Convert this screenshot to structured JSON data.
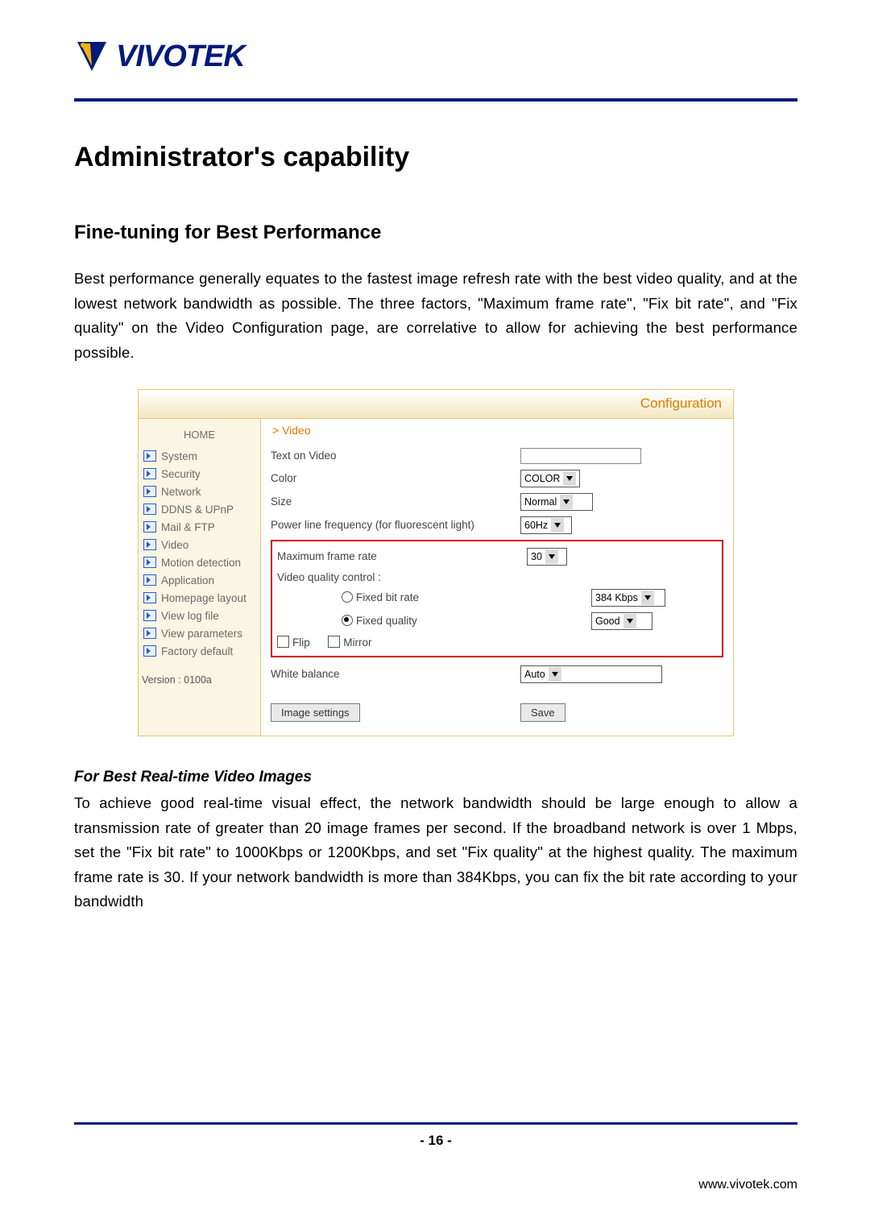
{
  "logo": {
    "text": "VIVOTEK"
  },
  "title": "Administrator's capability",
  "sub1": "Fine-tuning for Best Performance",
  "para1": "Best performance generally equates to the fastest image refresh rate with the best video quality, and at the lowest network bandwidth as possible. The three factors, \"Maximum frame rate\", \"Fix bit rate\", and \"Fix quality\" on the Video Configuration page, are correlative to allow for achieving the best performance possible.",
  "shot": {
    "title": "Configuration",
    "crumb": "> Video",
    "home": "HOME",
    "side": [
      "System",
      "Security",
      "Network",
      "DDNS & UPnP",
      "Mail & FTP",
      "Video",
      "Motion detection",
      "Application",
      "Homepage layout",
      "View log file",
      "View parameters",
      "Factory default"
    ],
    "version": "Version : 0100a",
    "labels": {
      "text_on_video": "Text on Video",
      "color": "Color",
      "size": "Size",
      "plf": "Power line frequency (for fluorescent light)",
      "mfr": "Maximum frame rate",
      "vqc": "Video quality control :",
      "fbr": "Fixed bit rate",
      "fq": "Fixed quality",
      "flip": "Flip",
      "mirror": "Mirror",
      "wb": "White balance"
    },
    "values": {
      "color": "COLOR",
      "size": "Normal",
      "plf": "60Hz",
      "mfr": "30",
      "fbr": "384 Kbps",
      "fq": "Good",
      "wb": "Auto"
    },
    "buttons": {
      "image_settings": "Image settings",
      "save": "Save"
    }
  },
  "sub2": "For Best Real-time Video Images",
  "para2": "To achieve good real-time visual effect, the network bandwidth should be large enough to allow a transmission rate of greater than 20 image frames per second. If the broadband network is over 1 Mbps, set the \"Fix bit rate\" to 1000Kbps or 1200Kbps, and set \"Fix quality\" at the highest quality. The maximum frame rate is 30. If your network bandwidth is more than 384Kbps, you can fix the bit rate according to your bandwidth",
  "page_number": "- 16 -",
  "site": "www.vivotek.com"
}
